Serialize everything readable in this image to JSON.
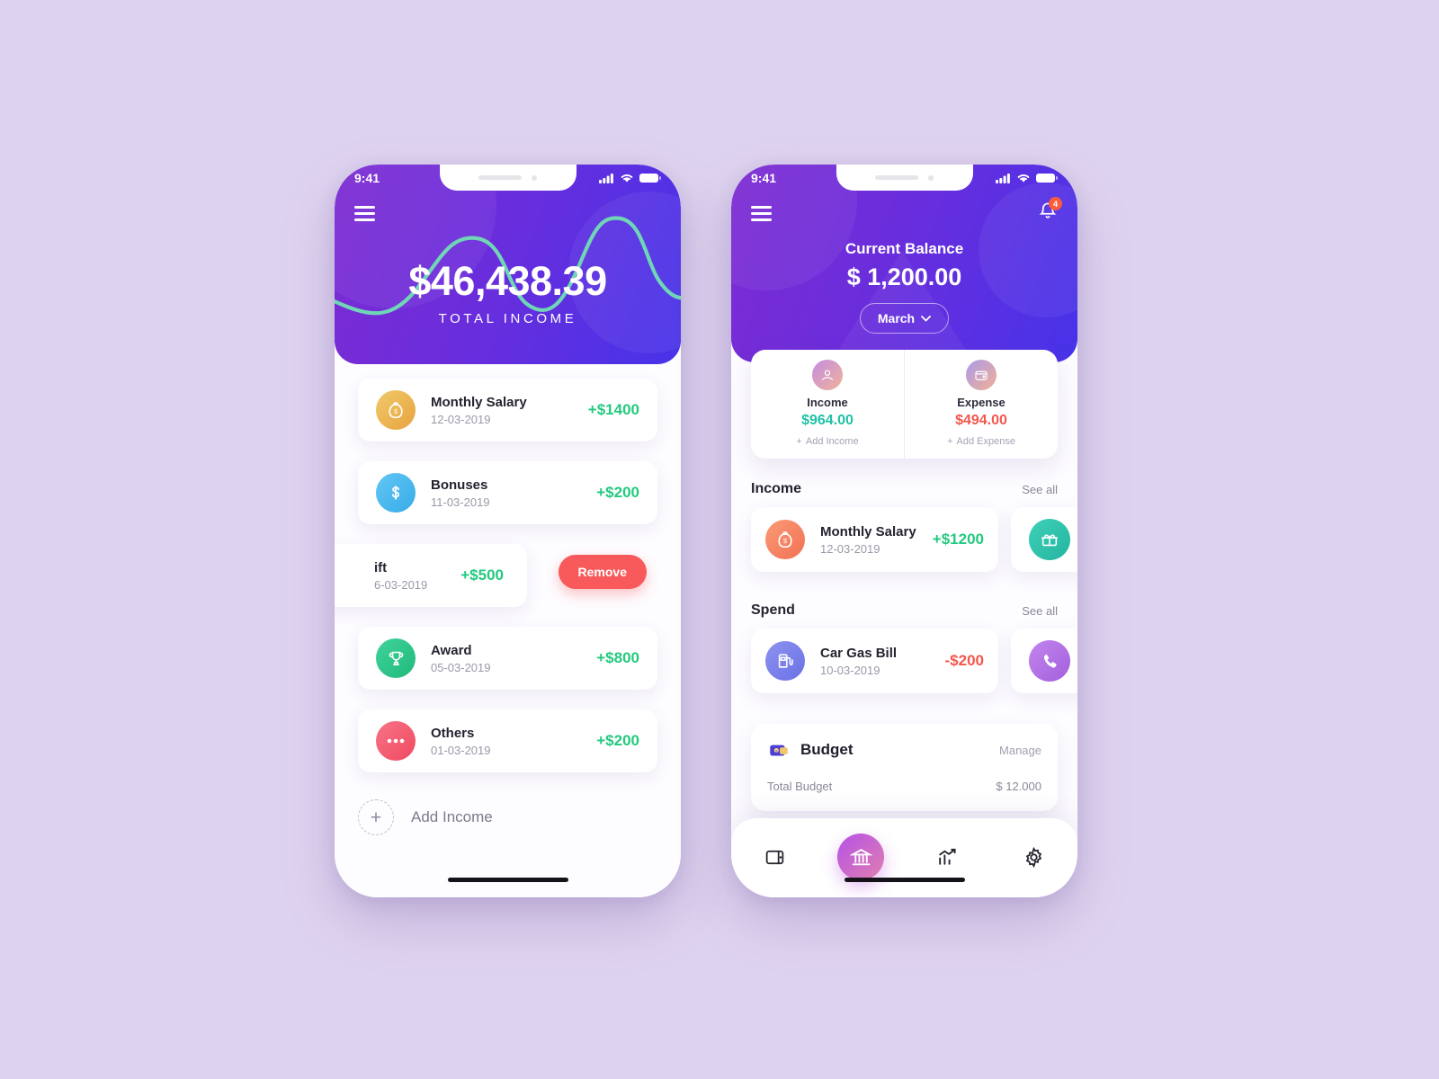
{
  "background_color": "#ded3ef",
  "phone_left": {
    "status_bar": {
      "time": "9:41",
      "signal_icon": "cellular-signal-icon",
      "wifi_icon": "wifi-icon",
      "battery_icon": "battery-icon"
    },
    "menu_icon": "hamburger-menu-icon",
    "hero": {
      "amount": "$46,438.39",
      "label": "TOTAL INCOME",
      "wave_color": "#6fd6b6",
      "gradient_from": "#7d2cd2",
      "gradient_to": "#4733e9"
    },
    "transactions": [
      {
        "icon": "money-bag-icon",
        "icon_color": "#edb24e",
        "title": "Monthly Salary",
        "date": "12-03-2019",
        "amount": "+$1400",
        "amount_type": "positive"
      },
      {
        "icon": "dollar-sign-icon",
        "icon_color": "#45b5ef",
        "title": "Bonuses",
        "date": "11-03-2019",
        "amount": "+$200",
        "amount_type": "positive"
      },
      {
        "icon": "gift-icon",
        "icon_color": "#8b7fe8",
        "title": "Gift",
        "title_clipped": "ift",
        "date": "6-03-2019",
        "amount": "+$500",
        "amount_type": "positive",
        "swiped": true,
        "remove_label": "Remove",
        "remove_color": "#f8595a"
      },
      {
        "icon": "trophy-icon",
        "icon_color": "#2ec189",
        "title": "Award",
        "date": "05-03-2019",
        "amount": "+$800",
        "amount_type": "positive"
      },
      {
        "icon": "ellipsis-icon",
        "icon_color": "#f2596d",
        "title": "Others",
        "date": "01-03-2019",
        "amount": "+$200",
        "amount_type": "positive"
      }
    ],
    "add_income": {
      "label": "Add Income",
      "icon": "plus-icon"
    }
  },
  "phone_right": {
    "status_bar": {
      "time": "9:41",
      "signal_icon": "cellular-signal-icon",
      "wifi_icon": "wifi-icon",
      "battery_icon": "battery-icon"
    },
    "menu_icon": "hamburger-menu-icon",
    "notification": {
      "icon": "bell-icon",
      "badge_count": "4",
      "badge_color": "#fa5d3c"
    },
    "hero": {
      "balance_label": "Current Balance",
      "balance_amount": "$ 1,200.00",
      "month": "March",
      "chevron_icon": "chevron-down-icon"
    },
    "summary": {
      "income": {
        "icon": "income-hand-coin-icon",
        "label": "Income",
        "value": "$964.00",
        "value_color": "#1fc2a5",
        "add_label": "Add Income"
      },
      "expense": {
        "icon": "expense-wallet-icon",
        "label": "Expense",
        "value": "$494.00",
        "value_color": "#f2574d",
        "add_label": "Add Expense"
      }
    },
    "income_section": {
      "title": "Income",
      "see_all": "See all",
      "item": {
        "icon": "money-bag-icon",
        "icon_color": "#f4845f",
        "title": "Monthly Salary",
        "date": "12-03-2019",
        "amount": "+$1200",
        "amount_type": "positive"
      },
      "side_card": {
        "icon": "gift-icon",
        "icon_color": "#2fc2ad"
      }
    },
    "spend_section": {
      "title": "Spend",
      "see_all": "See all",
      "item": {
        "icon": "fuel-pump-icon",
        "icon_color": "#7b80e8",
        "title": "Car Gas Bill",
        "date": "10-03-2019",
        "amount": "-$200",
        "amount_type": "negative"
      },
      "side_card": {
        "icon": "phone-icon",
        "icon_color": "#b069e2"
      }
    },
    "budget": {
      "icon": "wallet-money-icon",
      "title": "Budget",
      "manage_label": "Manage",
      "total_label": "Total Budget",
      "total_value": "$ 12.000"
    },
    "tabs": [
      {
        "icon": "wallet-icon",
        "active": false
      },
      {
        "icon": "bank-icon",
        "active": true
      },
      {
        "icon": "chart-growth-icon",
        "active": false
      },
      {
        "icon": "gear-icon",
        "active": false
      }
    ]
  }
}
